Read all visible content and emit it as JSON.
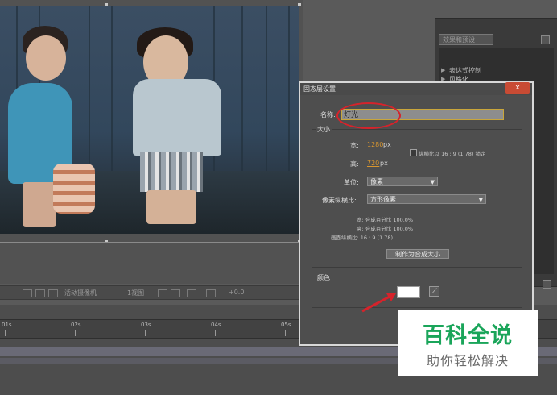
{
  "dialog": {
    "title": "固态层设置",
    "close_label": "x",
    "name_label": "名称:",
    "name_value": "灯光",
    "size_section_title": "大小",
    "width_label": "宽:",
    "width_value": "1280",
    "width_unit": "px",
    "height_label": "高:",
    "height_value": "720",
    "height_unit": "px",
    "lock_aspect_label": "纵横比以 16 : 9 (1.78) 锁定",
    "unit_label": "单位:",
    "unit_value": "像素",
    "pixel_aspect_label": "像素纵横比:",
    "pixel_aspect_value": "方形像素",
    "info_width": "宽: 合成百分比 100.0%",
    "info_height": "高: 合成百分比 100.0%",
    "info_frame_aspect": "画面纵横比: 16 : 9 (1.78)",
    "make_comp_size_button": "制作为合成大小",
    "color_section_title": "颜色",
    "color_value": "#ffffff",
    "eyedropper_icon": "eyedropper-icon"
  },
  "viewer_toolbar": {
    "camera_label": "活动摄像机",
    "view_label": "1视图",
    "offset_label": "+0.0"
  },
  "timeline": {
    "ruler_labels": [
      "01s",
      "02s",
      "03s",
      "04s",
      "05s"
    ]
  },
  "right_panel": {
    "tab_label": "效果和预设",
    "items": [
      "表达式控制",
      "风格化"
    ]
  },
  "watermark": {
    "title": "百科全说",
    "subtitle": "助你轻松解决"
  },
  "colors": {
    "annotation_red": "#d6232b",
    "accent_orange": "#d8962f",
    "watermark_green": "#1aa55a"
  }
}
